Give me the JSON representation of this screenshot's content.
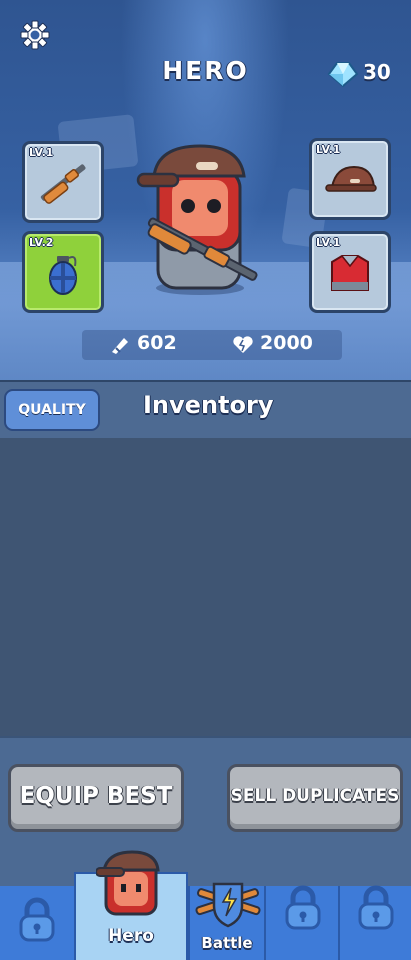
{
  "header": {
    "title": "HERO",
    "gems": "30"
  },
  "equipment": {
    "weapon": {
      "level": "LV.1"
    },
    "hat": {
      "level": "LV.1"
    },
    "grenade": {
      "level": "LV.2"
    },
    "armor": {
      "level": "LV.1"
    }
  },
  "stats": {
    "attack": "602",
    "health": "2000"
  },
  "inventory": {
    "filter_label": "QUALITY",
    "title": "Inventory"
  },
  "actions": {
    "equip_label": "EQUIP BEST",
    "sell_label": "SELL DUPLICATES"
  },
  "nav": {
    "hero_label": "Hero",
    "battle_label": "Battle"
  },
  "colors": {
    "accent_green": "#8fd13b",
    "nav_blue": "#3c77d3"
  }
}
